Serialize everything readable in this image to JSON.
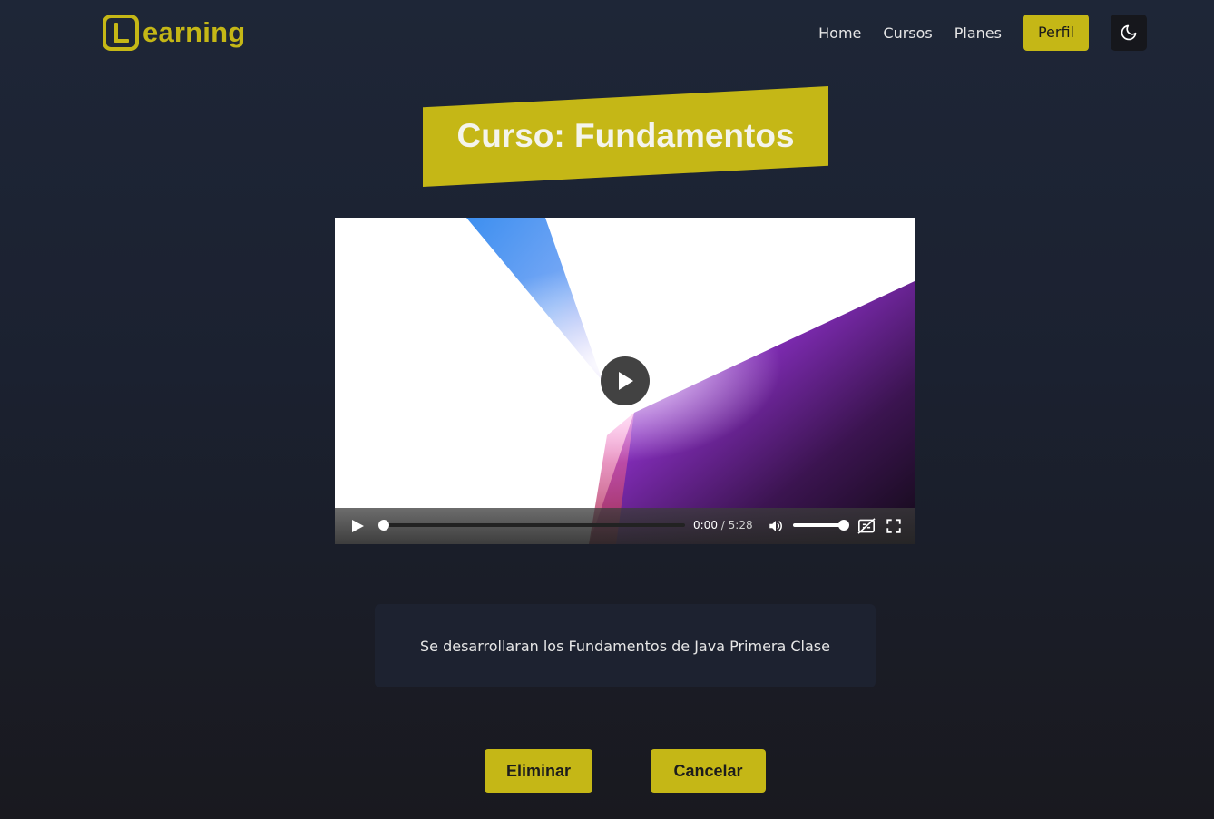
{
  "brand": {
    "logo_letter": "L",
    "logo_text": "earning",
    "color": "#c5b716"
  },
  "nav": {
    "links": [
      "Home",
      "Cursos",
      "Planes"
    ],
    "profile_label": "Perfil",
    "theme_icon": "moon-icon"
  },
  "course": {
    "title": "Curso: Fundamentos",
    "description": "Se desarrollaran los Fundamentos de Java Primera Clase"
  },
  "video": {
    "current_time": "0:00",
    "separator": "/",
    "duration": "5:28",
    "progress_fraction": 0.0,
    "volume_fraction": 1.0,
    "icons": [
      "play-icon",
      "volume-icon",
      "captions-off-icon",
      "fullscreen-icon"
    ]
  },
  "actions": {
    "delete_label": "Eliminar",
    "cancel_label": "Cancelar"
  },
  "colors": {
    "accent": "#c5b716",
    "background_top": "#1e2637",
    "background_bottom": "#19191f",
    "card": "#1d2230"
  }
}
